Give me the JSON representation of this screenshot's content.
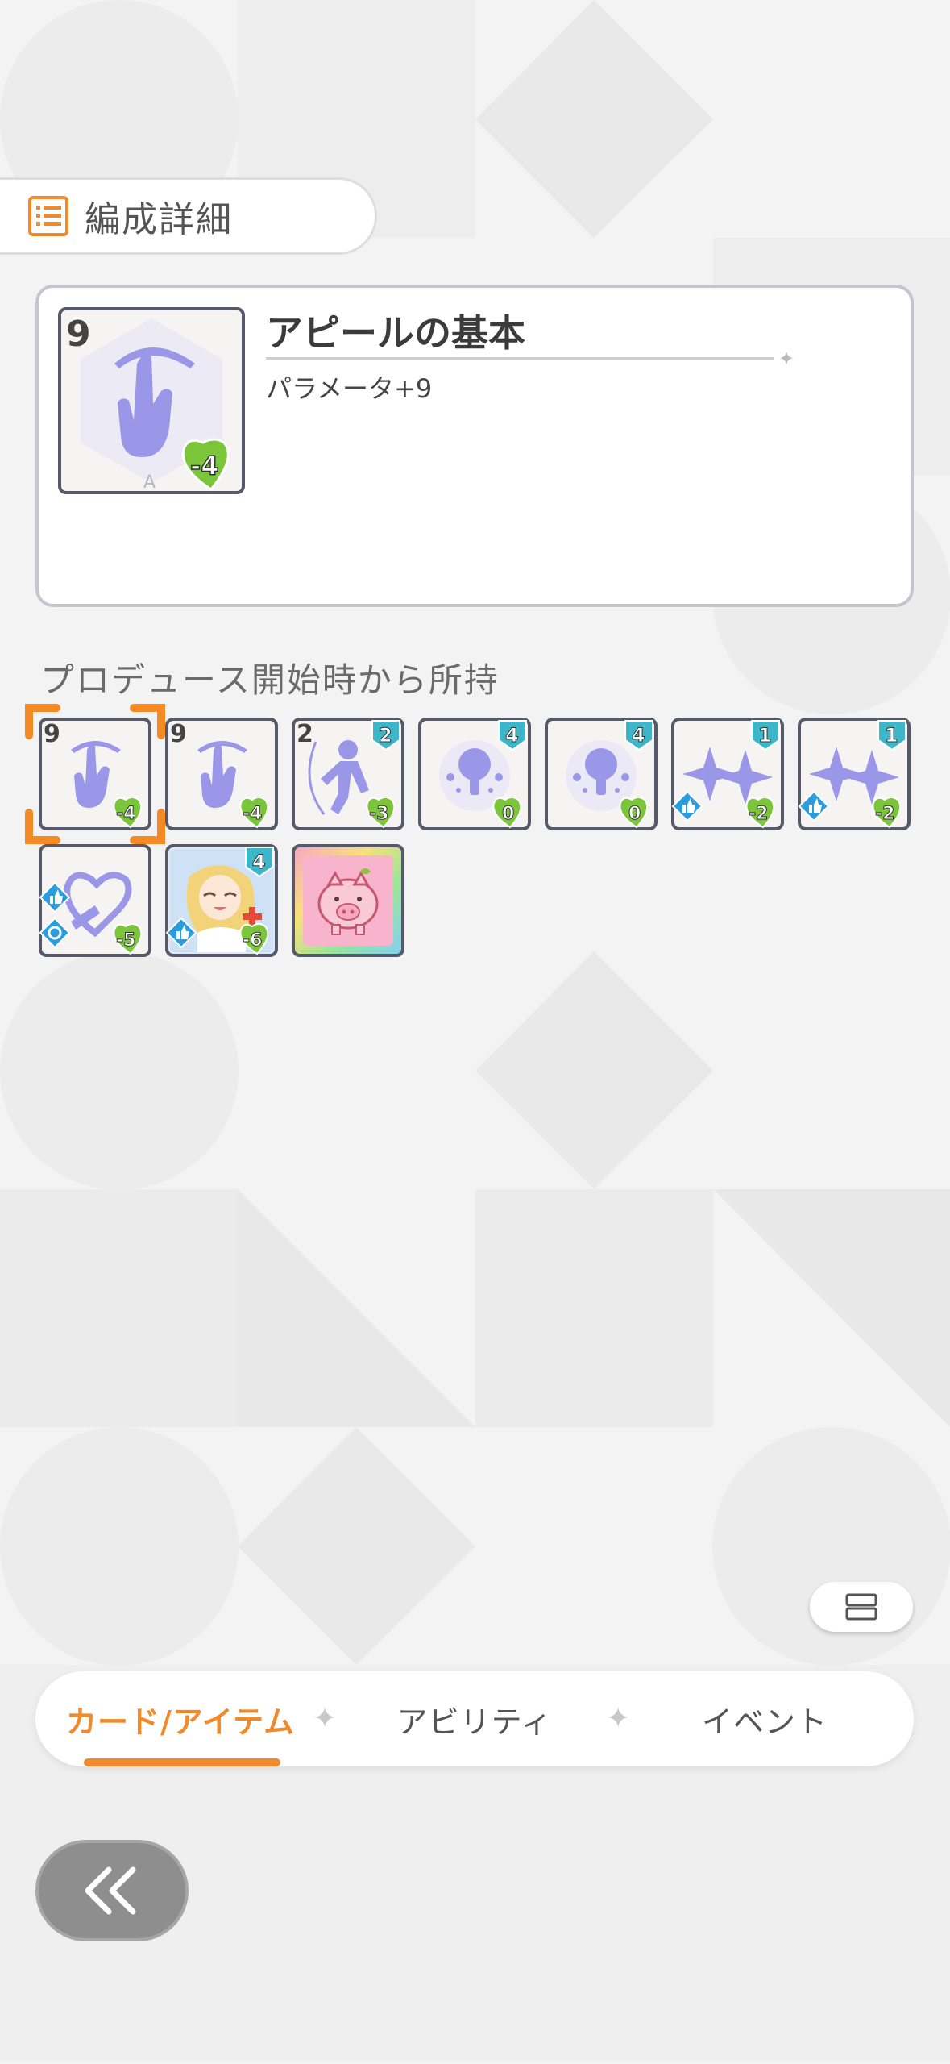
{
  "header": {
    "title": "編成詳細"
  },
  "detail": {
    "card_name": "アピールの基本",
    "effect": "パラメータ+9",
    "level": "9",
    "cost": "-4",
    "rank_letter": "A"
  },
  "section": {
    "label": "プロデュース開始時から所持"
  },
  "cards": [
    {
      "top": "9",
      "top_style": "plain",
      "cost": "-4",
      "icon": "hand-icon"
    },
    {
      "top": "9",
      "top_style": "plain",
      "cost": "-4",
      "icon": "hand-icon"
    },
    {
      "top": "2",
      "top_style": "plain",
      "badge": "2",
      "cost": "-3",
      "icon": "figure-icon"
    },
    {
      "badge": "4",
      "cost": "0",
      "icon": "bulb-icon"
    },
    {
      "badge": "4",
      "cost": "0",
      "icon": "bulb-icon"
    },
    {
      "badge": "1",
      "cost": "-2",
      "icon": "sparkle-icon"
    },
    {
      "badge": "1",
      "cost": "-2",
      "icon": "sparkle-icon"
    },
    {
      "cost": "-5",
      "icon": "heart-icon"
    },
    {
      "badge": "4",
      "cost": "-6",
      "icon": "idol-portrait"
    },
    {
      "icon": "piggy-bank-icon"
    }
  ],
  "tabs": [
    {
      "label": "カード/アイテム",
      "active": true
    },
    {
      "label": "アビリティ",
      "active": false
    },
    {
      "label": "イベント",
      "active": false
    }
  ],
  "tab_separator": "✦",
  "colors": {
    "accent": "#f08a2a",
    "icon_purple": "#9b97e8",
    "badge_teal": "#3cb6c8",
    "cost_green": "#7bc53a"
  }
}
